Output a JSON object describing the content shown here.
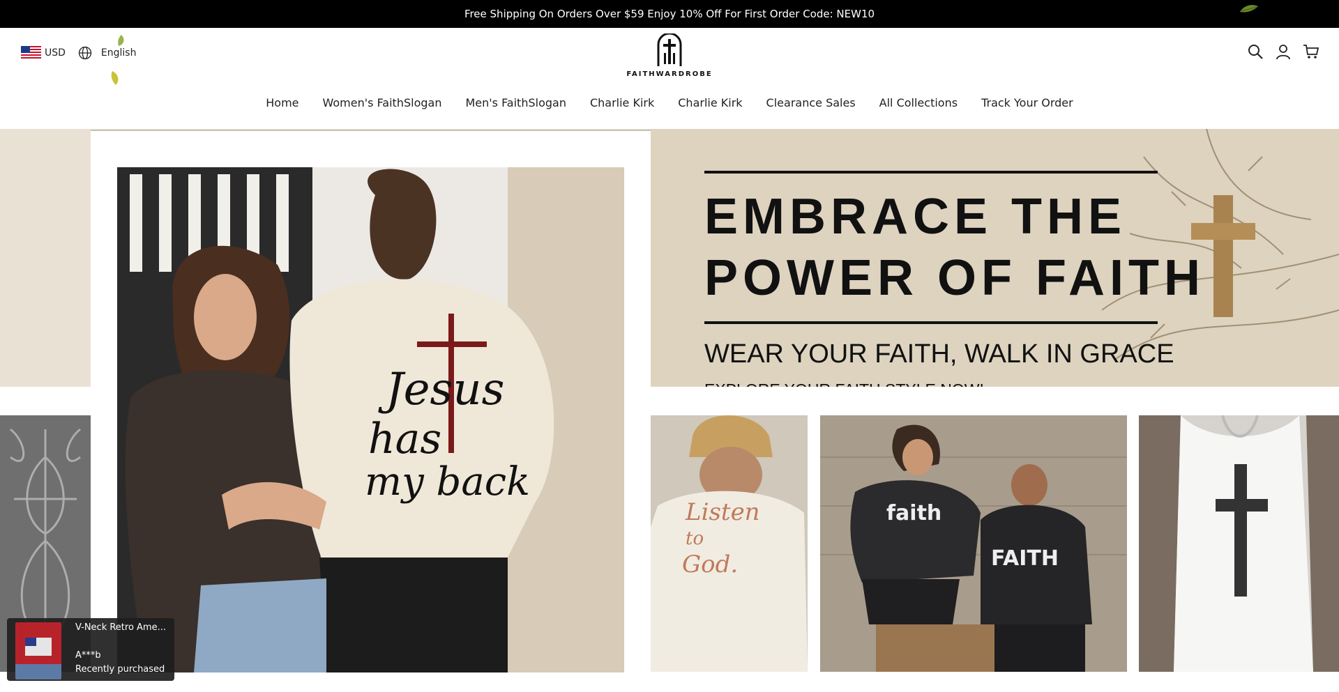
{
  "announcement": {
    "text": "Free Shipping On Orders Over $59 Enjoy 10% Off For First Order Code: NEW10"
  },
  "locale": {
    "currency": "USD",
    "language": "English"
  },
  "logo": {
    "text": "FAITHWARDROBE"
  },
  "nav": {
    "items": [
      {
        "label": "Home"
      },
      {
        "label": "Women's FaithSlogan"
      },
      {
        "label": "Men's FaithSlogan"
      },
      {
        "label": "Charlie Kirk"
      },
      {
        "label": "Charlie Kirk"
      },
      {
        "label": "Clearance Sales"
      },
      {
        "label": "All Collections"
      },
      {
        "label": "Track Your Order"
      }
    ]
  },
  "hero": {
    "headline_line1": "EMBRACE THE",
    "headline_line2": "POWER OF FAITH",
    "tagline": "WEAR YOUR FAITH, WALK IN GRACE",
    "cta_text": "EXPLORE YOUR FAITH STYLE NOW!"
  },
  "main_photo": {
    "shirt_line1": "Jesus",
    "shirt_line2": "has",
    "shirt_line3": "my back"
  },
  "tiles": [
    {
      "shirt_text_1": "Listen",
      "shirt_text_2": "to",
      "shirt_text_3": "God."
    },
    {
      "shirt_text_1": "faith",
      "shirt_text_2": "FAITH"
    },
    {
      "shirt_text_1": ""
    }
  ],
  "toast": {
    "product": "V-Neck Retro Ame...",
    "buyer": "A***b",
    "status": "Recently purchased"
  },
  "colors": {
    "announcement_bg": "#000000",
    "banner_bg": "#e9e2d4",
    "toast_bg": "#1e1e1e"
  }
}
